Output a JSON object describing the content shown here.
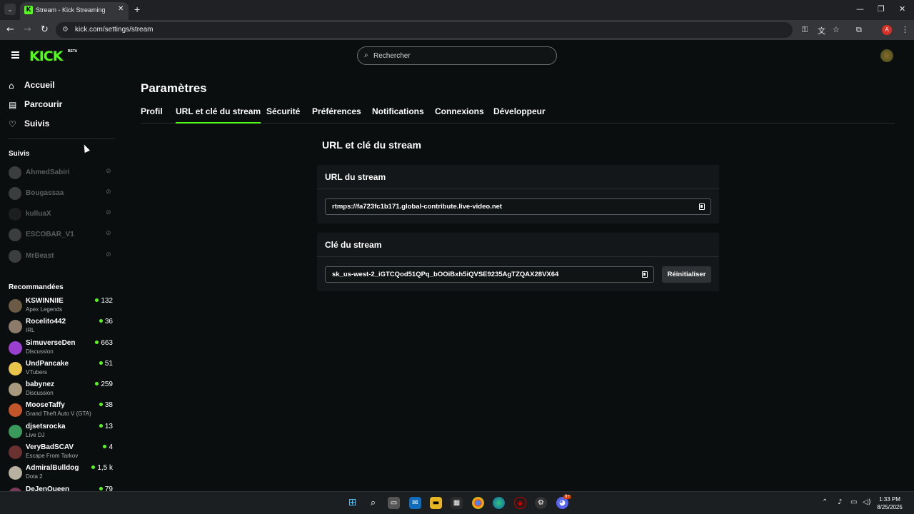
{
  "browser": {
    "tab_title": "Stream - Kick Streaming",
    "tab_favicon": "K",
    "url": "kick.com/settings/stream",
    "profile_initial": "A"
  },
  "header": {
    "logo": "KICK",
    "beta": "BETA",
    "search_placeholder": "Rechercher"
  },
  "sidebar": {
    "nav": [
      {
        "label": "Accueil",
        "icon": "home-icon"
      },
      {
        "label": "Parcourir",
        "icon": "browse-icon"
      },
      {
        "label": "Suivis",
        "icon": "heart-icon"
      }
    ],
    "following_title": "Suivis",
    "following": [
      {
        "name": "AhmedSabiri"
      },
      {
        "name": "Bougassaa"
      },
      {
        "name": "kulluaX"
      },
      {
        "name": "ESCOBAR_V1"
      },
      {
        "name": "MrBeast"
      }
    ],
    "recommended_title": "Recommandées",
    "recommended": [
      {
        "name": "KSWINNIIE",
        "category": "Apex Legends",
        "viewers": "132",
        "color": "#6b5a44"
      },
      {
        "name": "Rocelito442",
        "category": "IRL",
        "viewers": "36",
        "color": "#8c7b6b"
      },
      {
        "name": "SimuverseDen",
        "category": "Discussion",
        "viewers": "663",
        "color": "#9b3fd0"
      },
      {
        "name": "UndPancake",
        "category": "VTubers",
        "viewers": "51",
        "color": "#e8c44a"
      },
      {
        "name": "babynez",
        "category": "Discussion",
        "viewers": "259",
        "color": "#a89a7d"
      },
      {
        "name": "MooseTaffy",
        "category": "Grand Theft Auto V (GTA)",
        "viewers": "38",
        "color": "#c2562a"
      },
      {
        "name": "djsetsrocka",
        "category": "Live DJ",
        "viewers": "13",
        "color": "#3a9a5c"
      },
      {
        "name": "VeryBadSCAV",
        "category": "Escape From Tarkov",
        "viewers": "4",
        "color": "#6b3030"
      },
      {
        "name": "AdmiralBulldog",
        "category": "Dota 2",
        "viewers": "1,5 k",
        "color": "#b8b0a0"
      },
      {
        "name": "DeJenQueen",
        "category": "",
        "viewers": "79",
        "color": "#7a3a5a"
      }
    ]
  },
  "main": {
    "title": "Paramètres",
    "tabs": [
      "Profil",
      "URL et clé du stream",
      "Sécurité",
      "Préférences",
      "Notifications",
      "Connexions",
      "Développeur"
    ],
    "active_tab": "URL et clé du stream",
    "section_heading": "URL et clé du stream",
    "url_card": {
      "title": "URL du stream",
      "value": "rtmps://fa723fc1b171.global-contribute.live-video.net"
    },
    "key_card": {
      "title": "Clé du stream",
      "value": "sk_us-west-2_iGTCQod51QPq_bOOiBxh5iQVSE9235AgTZQAX28VX64",
      "reset_label": "Réinitialiser"
    }
  },
  "taskbar": {
    "time": "1:33 PM",
    "date": "8/25/2025",
    "discord_badge": "9+"
  },
  "colors": {
    "accent": "#53fc18",
    "background": "#0b0e0f",
    "card": "#141719"
  }
}
